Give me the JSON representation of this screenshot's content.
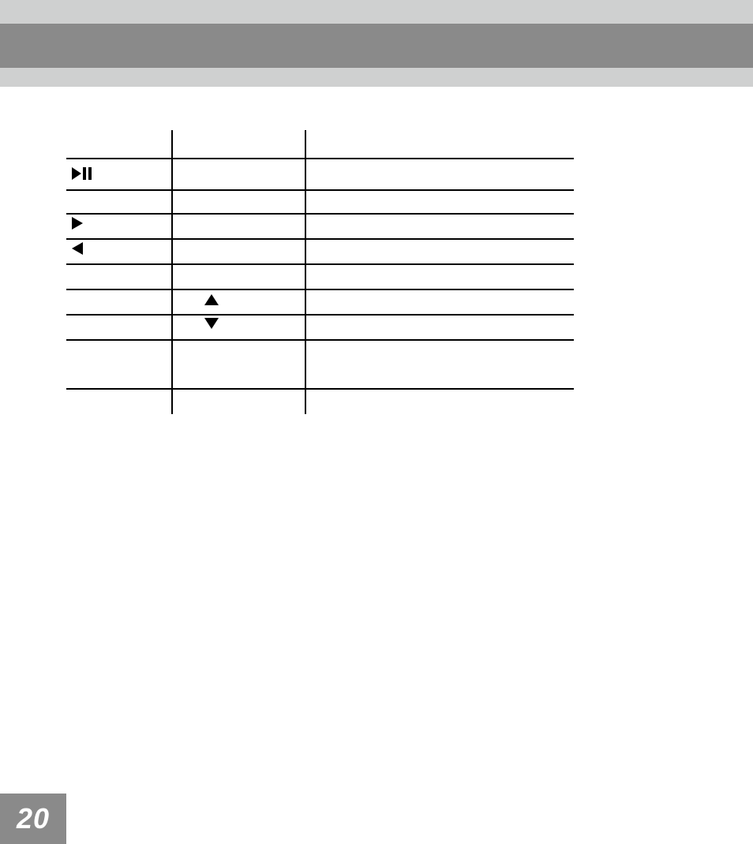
{
  "page": {
    "number": "20"
  },
  "icons": {
    "play_pause": "play-pause-icon",
    "play_right": "play-right-icon",
    "play_left": "play-left-icon",
    "arrow_up": "arrow-up-icon",
    "arrow_down": "arrow-down-icon"
  }
}
